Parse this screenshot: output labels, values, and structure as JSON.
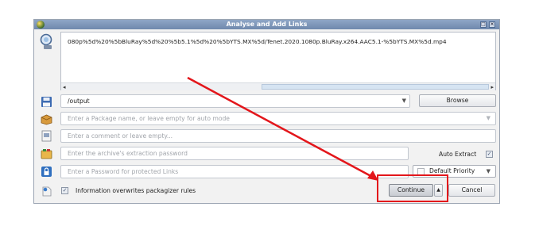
{
  "dialog": {
    "title": "Analyse and Add Links",
    "link_text": "080p%5d%20%5bBluRay%5d%20%5b5.1%5d%20%5bYTS.MX%5d/Tenet.2020.1080p.BluRay.x264.AAC5.1-%5bYTS.MX%5d.mp4"
  },
  "save_to": {
    "value": "/output",
    "browse_label": "Browse"
  },
  "package": {
    "placeholder": "Enter a Package name, or leave empty for auto mode"
  },
  "comment": {
    "placeholder": "Enter a comment or leave empty..."
  },
  "extraction": {
    "placeholder": "Enter the archive's extraction password",
    "auto_extract_label": "Auto Extract",
    "auto_extract_checked": true
  },
  "password": {
    "placeholder": "Enter a Password for protected Links",
    "priority_label": "Default Priority"
  },
  "footer": {
    "overwrite_label": "Information overwrites packagizer rules",
    "overwrite_checked": true,
    "continue_label": "Continue",
    "cancel_label": "Cancel"
  },
  "annotation": {
    "color": "#e3161b"
  }
}
